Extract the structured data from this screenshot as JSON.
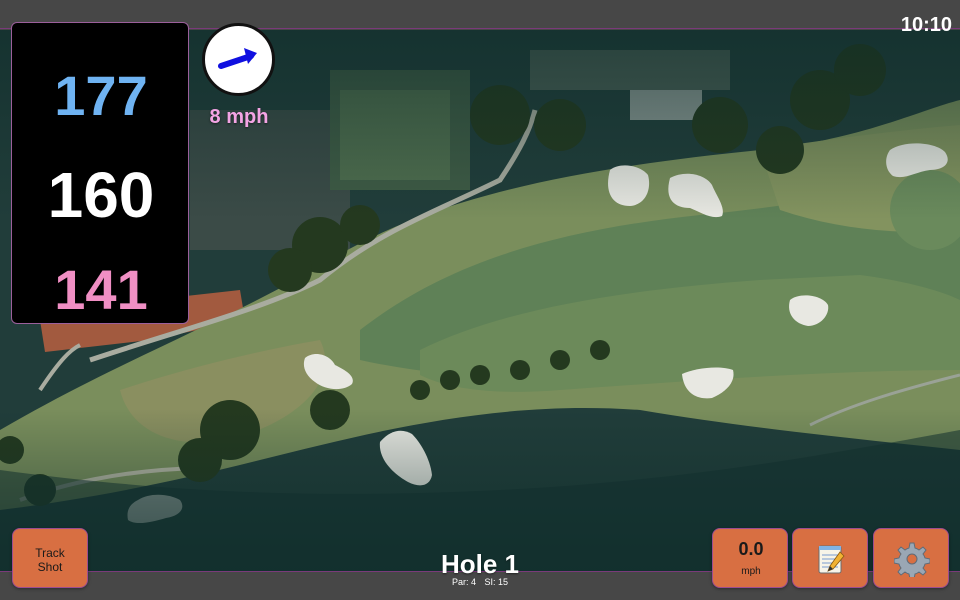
{
  "status_bar": {
    "time": "10:10"
  },
  "distances": {
    "back": "177",
    "middle": "160",
    "front": "141"
  },
  "wind": {
    "speed_text": "8 mph",
    "arrow_icon": "arrow-right-icon",
    "arrow_color": "#1010e0"
  },
  "hole": {
    "title": "Hole 1",
    "par_text": "Par: 4",
    "si_text": "SI: 15"
  },
  "buttons": {
    "track_shot_line1": "Track",
    "track_shot_line2": "Shot",
    "speed_value": "0.0",
    "speed_unit": "mph",
    "notes_icon": "notepad-icon",
    "settings_icon": "gear-icon"
  },
  "colors": {
    "back_distance": "#6fb3f2",
    "middle_distance": "#ffffff",
    "front_distance": "#f08fc4",
    "button_fill": "#d86f42",
    "accent_border": "#9c4c90"
  }
}
